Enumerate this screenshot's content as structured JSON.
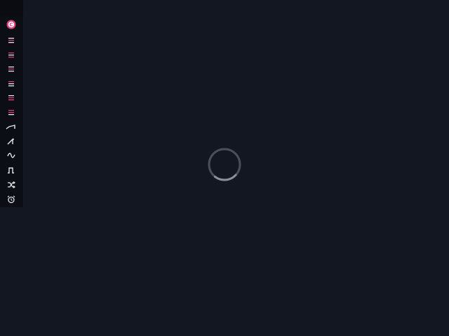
{
  "theme": {
    "background": "#131722",
    "sidebar_background": "#0c0e15",
    "accent": "#e0407a",
    "icon_color": "#e6e6e6",
    "spinner_track": "#4a4f5e",
    "spinner_arc": "#8a8f9c"
  },
  "sidebar": {
    "logo": {
      "icon": "logo-icon",
      "letter": "C"
    },
    "items": [
      {
        "icon": "layer-icon"
      },
      {
        "icon": "layer-icon"
      },
      {
        "icon": "layer-icon"
      },
      {
        "icon": "layer-icon"
      },
      {
        "icon": "layer-icon"
      },
      {
        "icon": "layer-icon"
      },
      {
        "icon": "ramp-wave-icon"
      },
      {
        "icon": "sawtooth-wave-icon"
      },
      {
        "icon": "sine-wave-icon"
      },
      {
        "icon": "square-wave-icon"
      },
      {
        "icon": "shuffle-icon"
      },
      {
        "icon": "alarm-clock-icon"
      }
    ]
  },
  "main": {
    "loading": true
  }
}
